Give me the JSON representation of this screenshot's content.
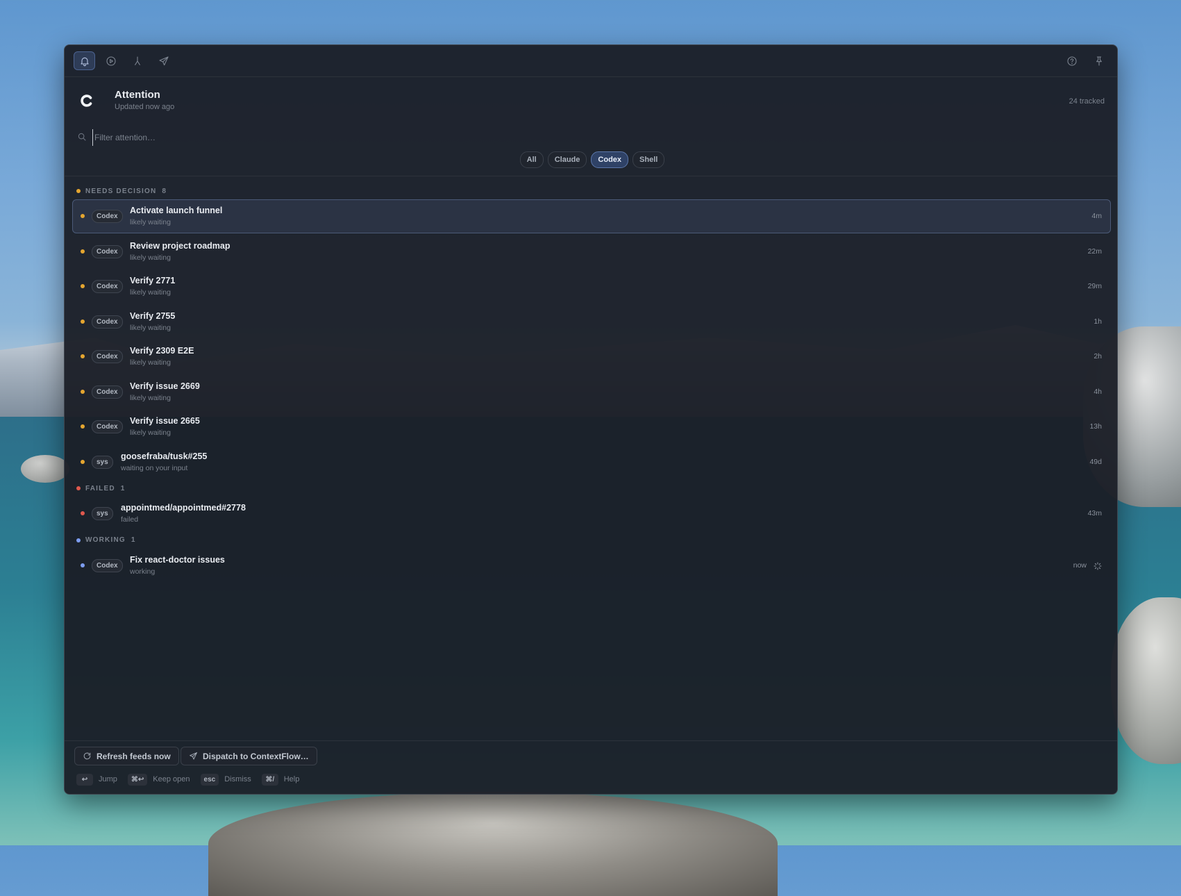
{
  "toolbar": {
    "tabs": [
      "bell-icon",
      "play-circle-icon",
      "merge-icon",
      "send-icon"
    ],
    "right_icons": [
      "help-icon",
      "pin-icon"
    ]
  },
  "header": {
    "title": "Attention",
    "subtitle": "Updated now ago",
    "tracked": "24 tracked"
  },
  "search": {
    "placeholder": "Filter attention…"
  },
  "filters": [
    {
      "label": "All",
      "active": false
    },
    {
      "label": "Claude",
      "active": false
    },
    {
      "label": "Codex",
      "active": true
    },
    {
      "label": "Shell",
      "active": false
    }
  ],
  "colors": {
    "needs_decision": "#e5a630",
    "failed": "#e0594e",
    "working": "#7d9df0",
    "accent": "#5b77aa"
  },
  "sections": [
    {
      "label": "NEEDS DECISION",
      "count": "8",
      "color": "#e5a630",
      "items": [
        {
          "tag": "Codex",
          "name": "Activate launch funnel",
          "status": "likely waiting",
          "time": "4m",
          "selected": true
        },
        {
          "tag": "Codex",
          "name": "Review project roadmap",
          "status": "likely waiting",
          "time": "22m"
        },
        {
          "tag": "Codex",
          "name": "Verify 2771",
          "status": "likely waiting",
          "time": "29m"
        },
        {
          "tag": "Codex",
          "name": "Verify 2755",
          "status": "likely waiting",
          "time": "1h"
        },
        {
          "tag": "Codex",
          "name": "Verify 2309 E2E",
          "status": "likely waiting",
          "time": "2h"
        },
        {
          "tag": "Codex",
          "name": "Verify issue 2669",
          "status": "likely waiting",
          "time": "4h"
        },
        {
          "tag": "Codex",
          "name": "Verify issue 2665",
          "status": "likely waiting",
          "time": "13h"
        },
        {
          "tag": "sys",
          "name": "goosefraba/tusk#255",
          "status": "waiting on your input",
          "time": "49d"
        }
      ]
    },
    {
      "label": "FAILED",
      "count": "1",
      "color": "#e0594e",
      "items": [
        {
          "tag": "sys",
          "name": "appointmed/appointmed#2778",
          "status": "failed",
          "time": "43m"
        }
      ]
    },
    {
      "label": "WORKING",
      "count": "1",
      "color": "#7d9df0",
      "items": [
        {
          "tag": "Codex",
          "name": "Fix react-doctor issues",
          "status": "working",
          "time": "now",
          "spinner": true
        }
      ]
    }
  ],
  "footer": {
    "refresh_label": "Refresh feeds now",
    "dispatch_label": "Dispatch to ContextFlow…",
    "hints": [
      {
        "key": "↩",
        "label": "Jump"
      },
      {
        "key": "⌘↩",
        "label": "Keep open"
      },
      {
        "key": "esc",
        "label": "Dismiss"
      },
      {
        "key": "⌘/",
        "label": "Help"
      }
    ]
  }
}
